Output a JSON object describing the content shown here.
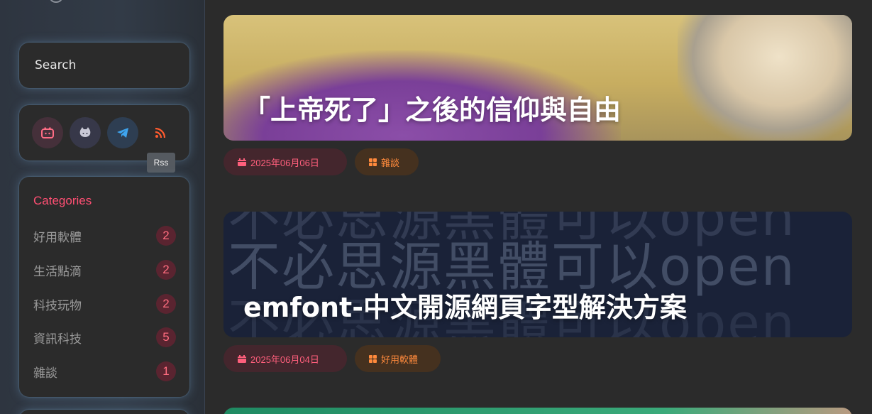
{
  "sidebar": {
    "search": {
      "placeholder": "Search"
    },
    "social": [
      {
        "icon": "bilibili-icon",
        "color": "#ff6d85"
      },
      {
        "icon": "github-icon",
        "color": "#c9c9d6"
      },
      {
        "icon": "telegram-icon",
        "color": "#3ea4ee"
      },
      {
        "icon": "rss-icon",
        "color": "#ff5b2e"
      }
    ],
    "tooltip": "Rss",
    "categories": {
      "title": "Categories",
      "items": [
        {
          "label": "好用軟體",
          "count": "2"
        },
        {
          "label": "生活點滴",
          "count": "2"
        },
        {
          "label": "科技玩物",
          "count": "2"
        },
        {
          "label": "資訊科技",
          "count": "5"
        },
        {
          "label": "雜談",
          "count": "1"
        }
      ]
    }
  },
  "posts": [
    {
      "title": "「上帝死了」之後的信仰與自由",
      "date": "2025年06月06日",
      "category": "雜談"
    },
    {
      "title": "emfont-中文開源網頁字型解決方案",
      "cover_text": "不必思源黑體可以open",
      "date": "2025年06月04日",
      "category": "好用軟體"
    }
  ],
  "colors": {
    "accent": "#ff4f73",
    "tag_date_text": "#ff5f7c",
    "tag_category_text": "#ff8a3c"
  }
}
